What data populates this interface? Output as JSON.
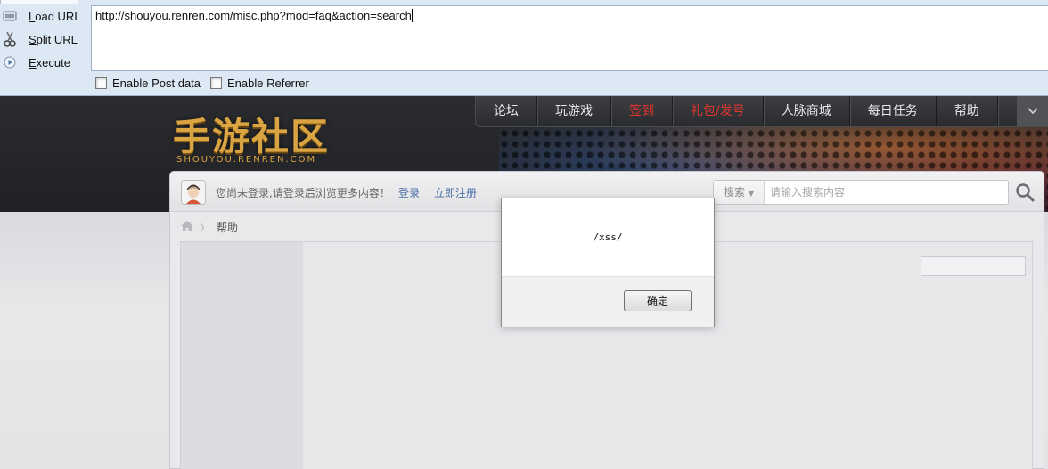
{
  "hackbar": {
    "load_url_label": "Load URL",
    "split_url_label": "Split URL",
    "execute_label": "Execute",
    "url_value": "http://shouyou.renren.com/misc.php?mod=faq&action=search",
    "enable_post_label": "Enable Post data",
    "enable_referrer_label": "Enable Referrer"
  },
  "site": {
    "logo_text": "手游社区",
    "logo_sub": "SHOUYOU.RENREN.COM",
    "nav": [
      {
        "label": "论坛",
        "color": "#e8e8e8"
      },
      {
        "label": "玩游戏",
        "color": "#e8e8e8"
      },
      {
        "label": "签到",
        "color": "#e0342d"
      },
      {
        "label": "礼包/发号",
        "color": "#e0342d"
      },
      {
        "label": "人脉商城",
        "color": "#e8e8e8"
      },
      {
        "label": "每日任务",
        "color": "#e8e8e8"
      },
      {
        "label": "帮助",
        "color": "#e8e8e8"
      }
    ],
    "login_prompt": "您尚未登录,请登录后浏览更多内容！",
    "login_link": "登录",
    "register_link": "立即注册",
    "search_scope": "搜索",
    "search_placeholder": "请输入搜索内容",
    "breadcrumb_current": "帮助"
  },
  "alert": {
    "message": "/xss/",
    "ok_label": "确定"
  }
}
